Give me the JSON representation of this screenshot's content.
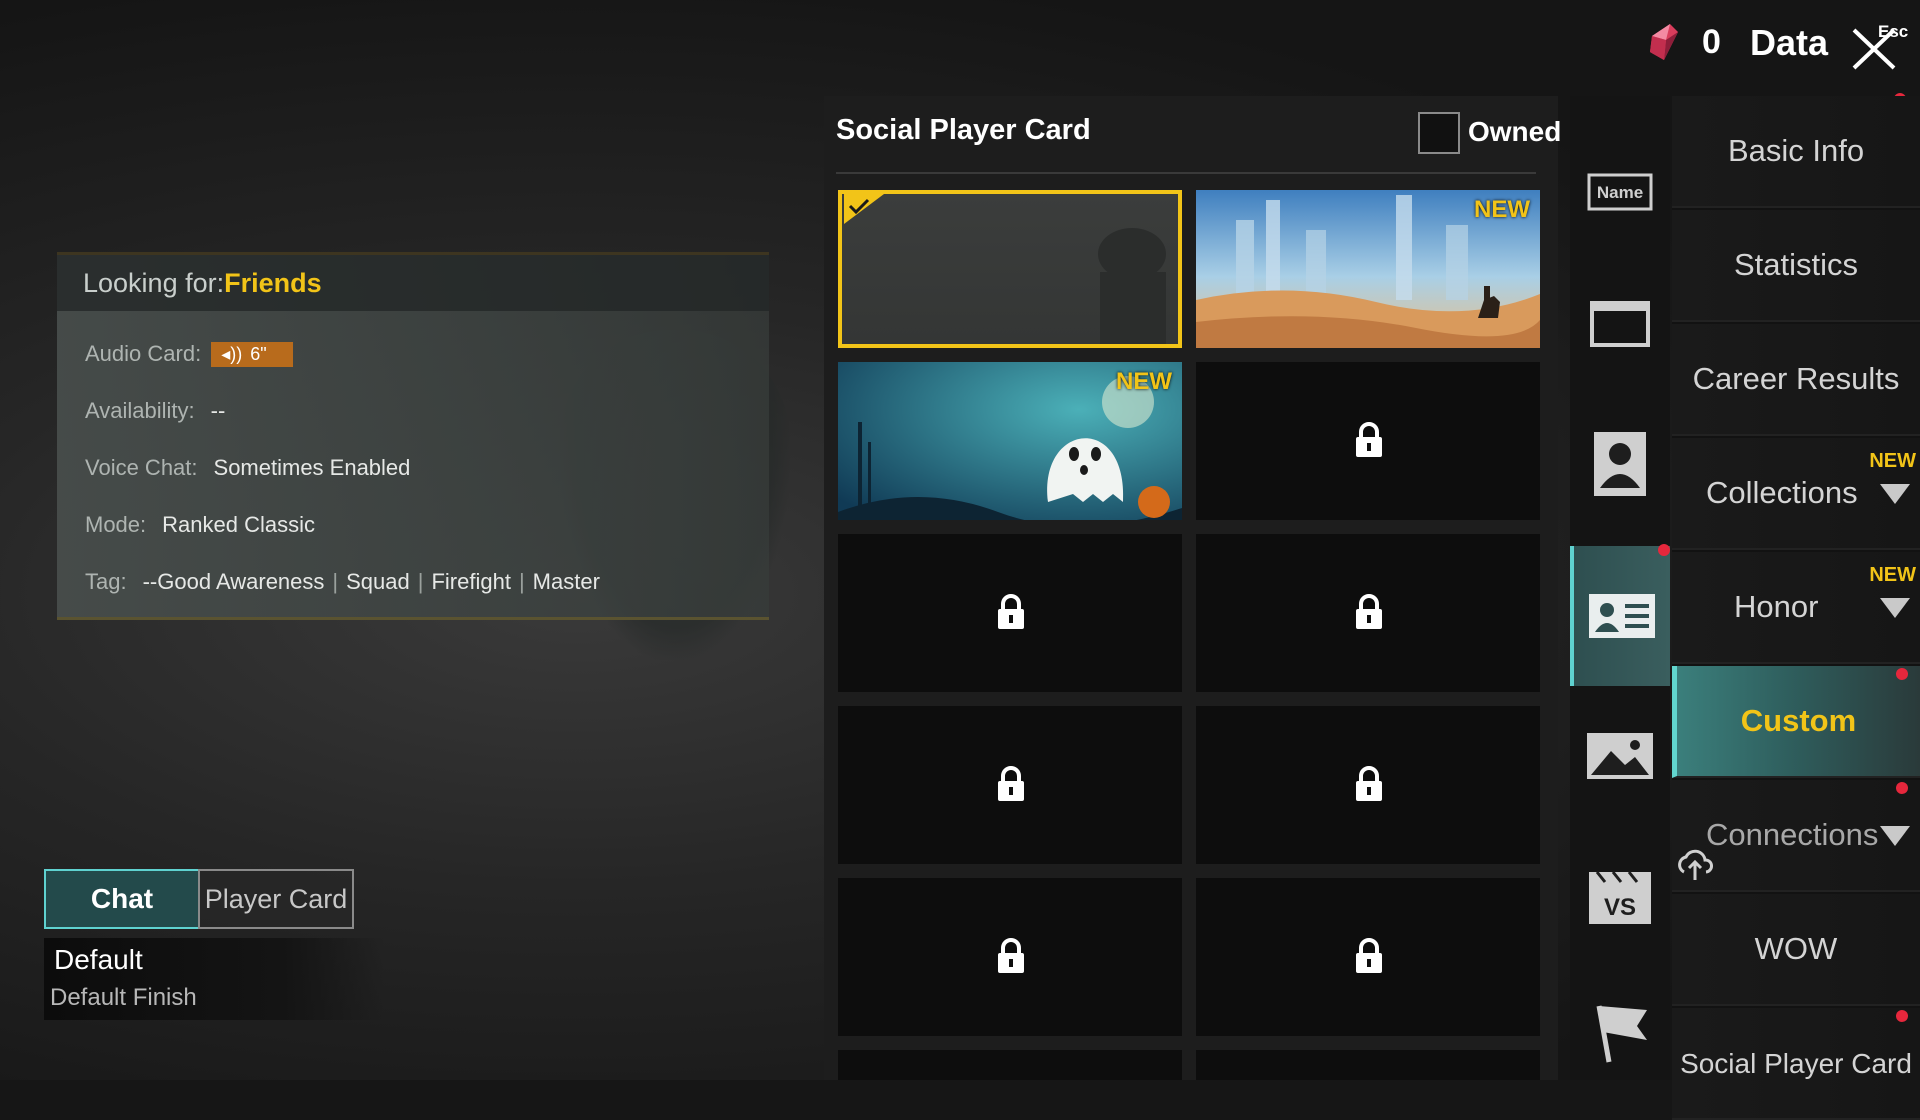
{
  "topbar": {
    "currency_amount": "0",
    "title": "Data",
    "close_hint": "Esc",
    "currency_icon": "gem-icon"
  },
  "info_card": {
    "looking_label": "Looking for:",
    "looking_value": "Friends",
    "audio_label": "Audio Card:",
    "audio_value": "6\"",
    "availability_label": "Availability:",
    "availability_value": "--",
    "voice_label": "Voice Chat:",
    "voice_value": "Sometimes Enabled",
    "mode_label": "Mode:",
    "mode_value": "Ranked Classic",
    "tag_label": "Tag:",
    "tags": [
      "--Good Awareness",
      "Squad",
      "Firefight",
      "Master"
    ]
  },
  "bottom_left": {
    "tab_chat": "Chat",
    "tab_player_card": "Player Card",
    "finish_name": "Default",
    "finish_sub": "Default Finish"
  },
  "grid": {
    "title": "Social Player Card",
    "owned_label": "Owned",
    "new_badge": "NEW",
    "cards": [
      {
        "id": "default",
        "selected": true,
        "locked": false,
        "new": false
      },
      {
        "id": "desert-rider",
        "selected": false,
        "locked": false,
        "new": true
      },
      {
        "id": "ghost-halloween",
        "selected": false,
        "locked": false,
        "new": true
      },
      {
        "id": "locked-4",
        "locked": true
      },
      {
        "id": "locked-5",
        "locked": true
      },
      {
        "id": "locked-6",
        "locked": true
      },
      {
        "id": "locked-7",
        "locked": true
      },
      {
        "id": "locked-8",
        "locked": true
      },
      {
        "id": "locked-9",
        "locked": true
      },
      {
        "id": "locked-10",
        "locked": true
      }
    ]
  },
  "icon_tabs": [
    {
      "name": "name-tag-icon"
    },
    {
      "name": "frame-icon"
    },
    {
      "name": "avatar-icon"
    },
    {
      "name": "player-card-icon",
      "active": true
    },
    {
      "name": "landscape-icon"
    },
    {
      "name": "vs-icon"
    },
    {
      "name": "flag-icon"
    }
  ],
  "nav": {
    "basic_info": "Basic Info",
    "statistics": "Statistics",
    "career_results": "Career Results",
    "collections": "Collections",
    "honor": "Honor",
    "custom": "Custom",
    "connections": "Connections",
    "wow": "WOW",
    "social_player_card": "Social Player Card",
    "new_badge": "NEW"
  },
  "colors": {
    "accent_yellow": "#f2c418",
    "accent_teal": "#5fd2d0",
    "alert_red": "#e6273c"
  }
}
